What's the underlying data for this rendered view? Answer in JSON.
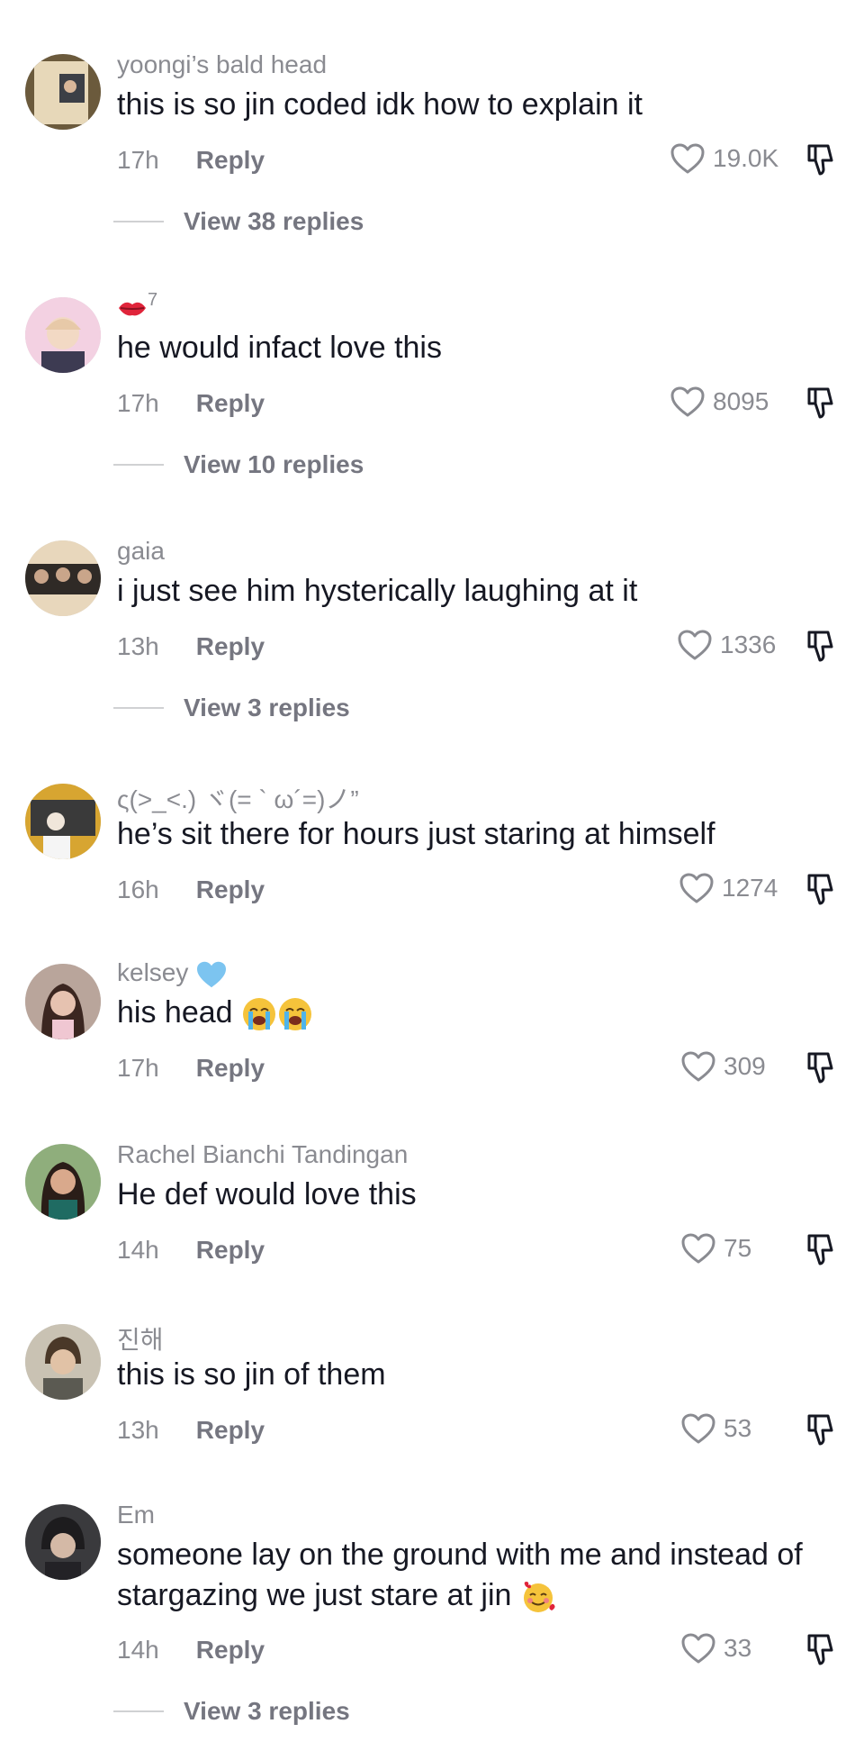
{
  "reply_label": "Reply",
  "comments": [
    {
      "username": "yoongi’s bald head",
      "text": "this is so jin coded idk how to explain it",
      "time": "17h",
      "likes": "19.0K",
      "view_replies": "View 38 replies",
      "avatar_icon": "avatar-photo-icon"
    },
    {
      "username": "7",
      "username_icon": "lips-kiss-icon",
      "text": "he would infact love this",
      "time": "17h",
      "likes": "8095",
      "view_replies": "View 10 replies",
      "avatar_icon": "avatar-photo-icon"
    },
    {
      "username": "gaia",
      "text": "i just see him hysterically laughing at it",
      "time": "13h",
      "likes": "1336",
      "view_replies": "View 3 replies",
      "avatar_icon": "avatar-photo-icon"
    },
    {
      "username": "ς(>_<.) ヾ(= ` ω´=)ノ”",
      "text": "he’s sit there for hours just staring at himself",
      "time": "16h",
      "likes": "1274",
      "avatar_icon": "avatar-photo-icon"
    },
    {
      "username": "kelsey",
      "username_icon": "blue-heart-icon",
      "text": "his head",
      "text_icon": "loudly-crying-face-icon",
      "time": "17h",
      "likes": "309",
      "avatar_icon": "avatar-photo-icon"
    },
    {
      "username": "Rachel Bianchi Tandingan",
      "text": "He def would love this",
      "time": "14h",
      "likes": "75",
      "avatar_icon": "avatar-photo-icon"
    },
    {
      "username": "진해",
      "text": "this is so jin of them",
      "time": "13h",
      "likes": "53",
      "avatar_icon": "avatar-photo-icon"
    },
    {
      "username": "Em",
      "text": "someone lay on the ground with me and instead of stargazing we just stare at jin",
      "text_icon": "smiling-face-with-hearts-icon",
      "time": "14h",
      "likes": "33",
      "view_replies": "View 3 replies",
      "avatar_icon": "avatar-photo-icon"
    }
  ],
  "colors": {
    "text": "#161823",
    "secondary": "#8a8b91",
    "reply": "#757680",
    "blue_heart": "#7cc4f0"
  }
}
